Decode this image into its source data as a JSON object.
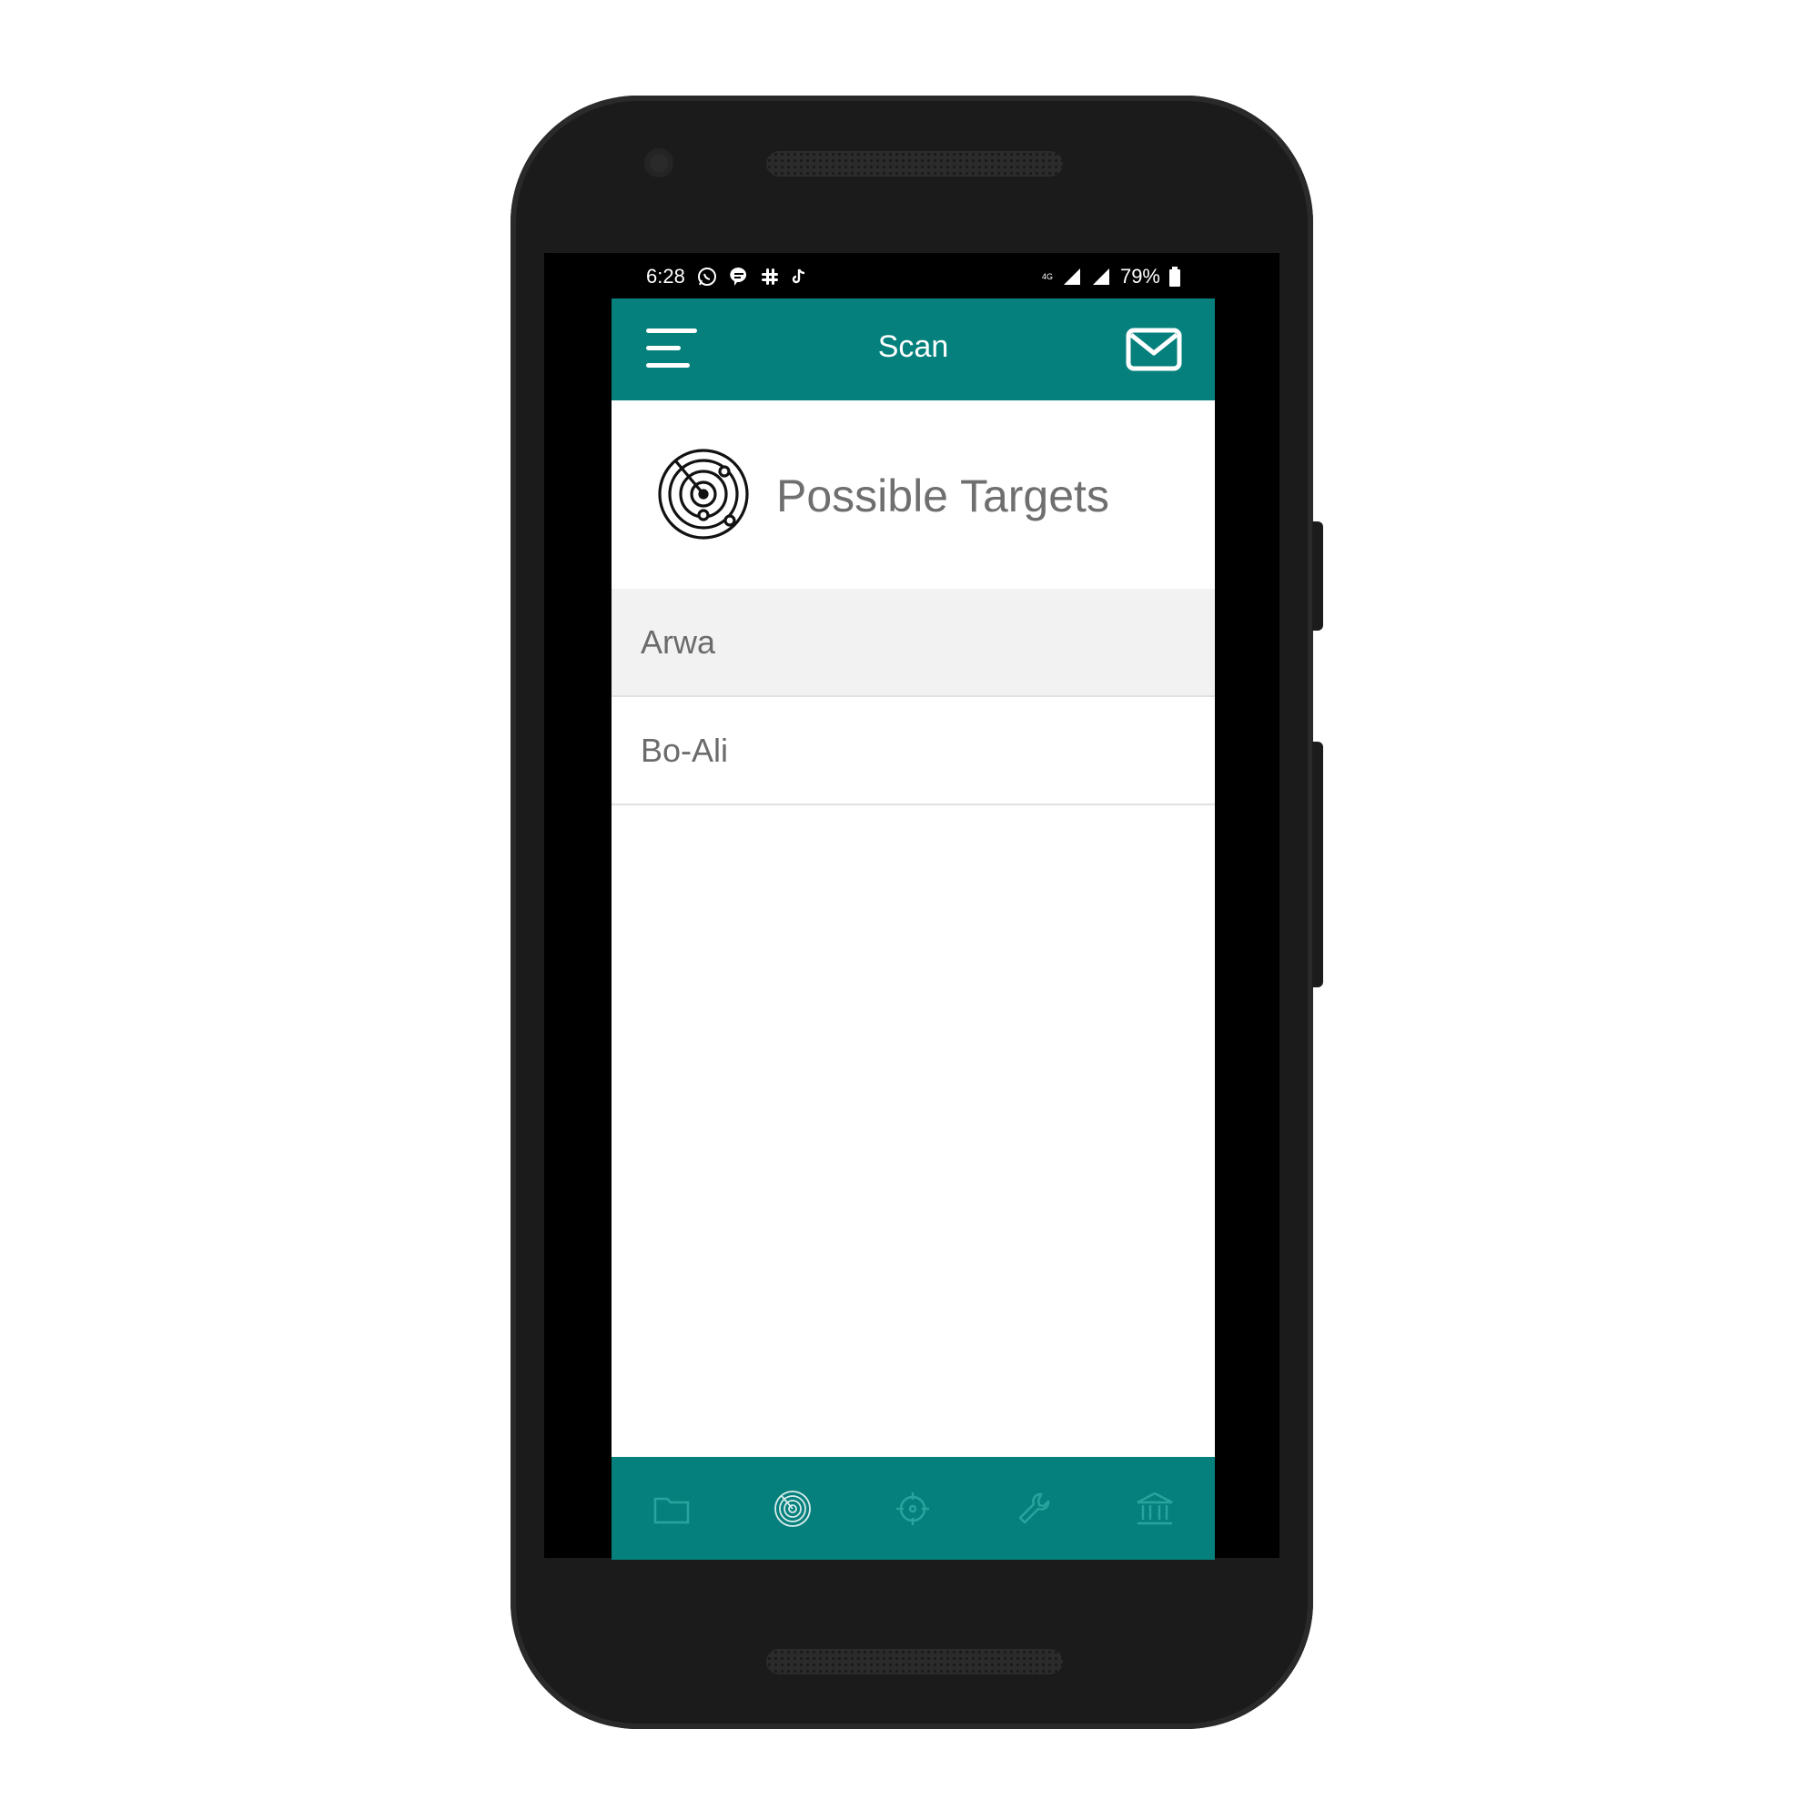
{
  "status_bar": {
    "time": "6:28",
    "notification_icons": [
      "whatsapp-icon",
      "chat-bubble-icon",
      "slack-icon",
      "tiktok-icon"
    ],
    "network": "4G",
    "battery": "79%"
  },
  "header": {
    "title": "Scan",
    "color": "#05807c"
  },
  "section": {
    "title": "Possible Targets",
    "icon": "radar-icon"
  },
  "targets": [
    {
      "name": "Arwa",
      "selected": true
    },
    {
      "name": "Bo-Ali",
      "selected": false
    }
  ],
  "bottom_nav": {
    "items": [
      "folder-icon",
      "radar-icon",
      "crosshair-icon",
      "wrench-icon",
      "bank-icon"
    ],
    "active_index": 1
  }
}
